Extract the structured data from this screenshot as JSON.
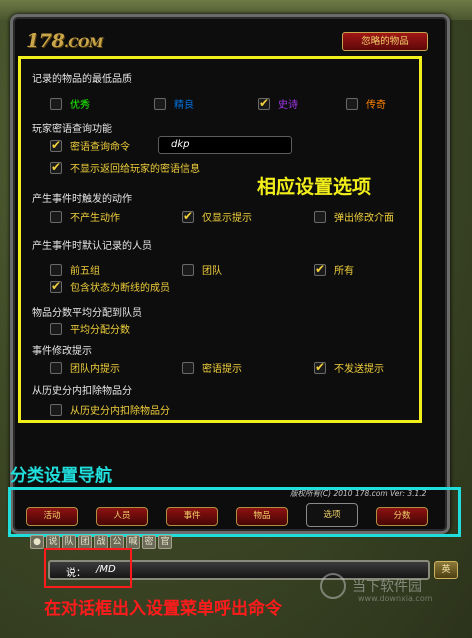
{
  "window": {
    "logo": {
      "num": "178",
      "sup": "",
      "com": ".COM"
    },
    "ignored_button": "忽略的物品"
  },
  "sections": {
    "min_quality": {
      "title": "记录的物品的最低品质",
      "options": [
        {
          "label": "优秀",
          "checked": false,
          "color": "#1eff00"
        },
        {
          "label": "精良",
          "checked": false,
          "color": "#0070dd"
        },
        {
          "label": "史诗",
          "checked": true,
          "color": "#a335ee"
        },
        {
          "label": "传奇",
          "checked": false,
          "color": "#ff8000"
        }
      ]
    },
    "whisper": {
      "title": "玩家密语查询功能",
      "cmd_label": "密语查询命令",
      "cmd_checked": true,
      "cmd_value": "dkp",
      "hide_label": "不显示返回给玩家的密语信息",
      "hide_checked": true
    },
    "trigger": {
      "title": "产生事件时触发的动作",
      "options": [
        {
          "label": "不产生动作",
          "checked": false
        },
        {
          "label": "仅显示提示",
          "checked": true
        },
        {
          "label": "弹出修改介面",
          "checked": false
        }
      ]
    },
    "members": {
      "title": "产生事件时默认记录的人员",
      "options": [
        {
          "label": "前五组",
          "checked": false
        },
        {
          "label": "团队",
          "checked": false
        },
        {
          "label": "所有",
          "checked": true
        }
      ],
      "offline_label": "包含状态为断线的成员",
      "offline_checked": true
    },
    "split": {
      "title": "物品分数平均分配到队员",
      "label": "平均分配分数",
      "checked": false
    },
    "modify_hint": {
      "title": "事件修改提示",
      "options": [
        {
          "label": "团队内提示",
          "checked": false
        },
        {
          "label": "密语提示",
          "checked": false
        },
        {
          "label": "不发送提示",
          "checked": true
        }
      ]
    },
    "deduct": {
      "title": "从历史分内扣除物品分",
      "label": "从历史分内扣除物品分",
      "checked": false
    }
  },
  "overlays": {
    "options_caption": "相应设置选项",
    "nav_caption": "分类设置导航",
    "chat_caption": "在对话框出入设置菜单呼出命令"
  },
  "copyright": "版权所有(C) 2010 178.com  Ver: 3.1.2",
  "tabs": [
    {
      "label": "活动",
      "active": false
    },
    {
      "label": "人员",
      "active": false
    },
    {
      "label": "事件",
      "active": false
    },
    {
      "label": "物品",
      "active": false
    },
    {
      "label": "选项",
      "active": true
    },
    {
      "label": "分数",
      "active": false
    }
  ],
  "chat": {
    "channel_tabs": [
      "●",
      "说",
      "队",
      "团",
      "战",
      "公",
      "喊",
      "密",
      "官"
    ],
    "say_label": "说：",
    "command": "/MD",
    "lang_button": "英"
  },
  "watermark": {
    "text": "当下软件园",
    "sub": "www.downxia.com"
  }
}
